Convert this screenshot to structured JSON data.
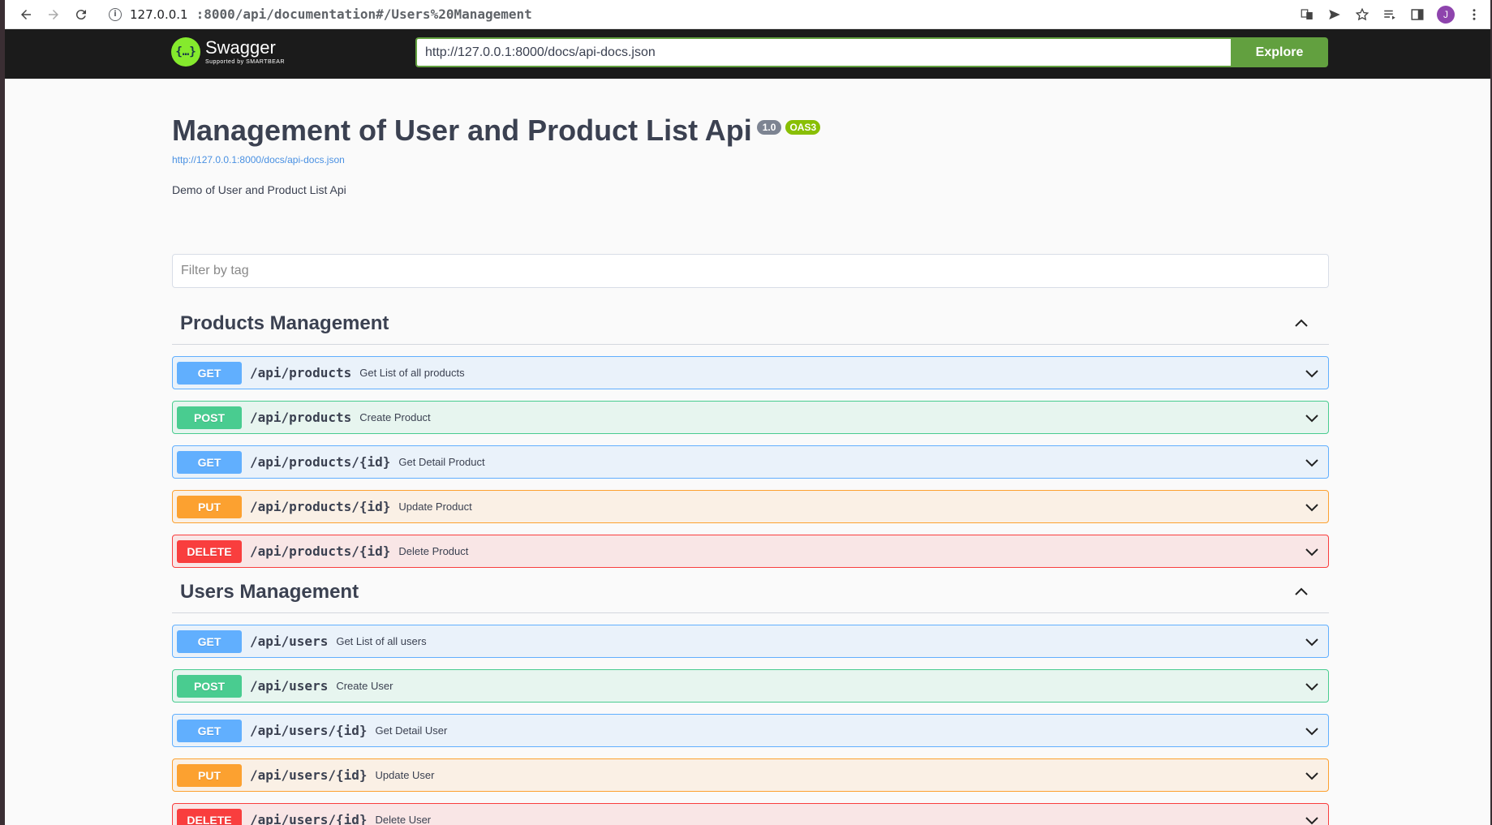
{
  "browser": {
    "url_host": "127.0.0.1",
    "url_path": ":8000/api/documentation#/Users%20Management",
    "avatar_letter": "J"
  },
  "topbar": {
    "logo_name": "Swagger",
    "logo_tagline": "Supported by SMARTBEAR",
    "spec_url": "http://127.0.0.1:8000/docs/api-docs.json",
    "explore_label": "Explore"
  },
  "info": {
    "title": "Management of User and Product List Api",
    "version": "1.0",
    "oas": "OAS3",
    "spec_link": "http://127.0.0.1:8000/docs/api-docs.json",
    "description": "Demo of User and Product List Api"
  },
  "filter": {
    "placeholder": "Filter by tag"
  },
  "sections": [
    {
      "title": "Products Management",
      "ops": [
        {
          "method": "GET",
          "path": "/api/products",
          "summary": "Get List of all products"
        },
        {
          "method": "POST",
          "path": "/api/products",
          "summary": "Create Product"
        },
        {
          "method": "GET",
          "path": "/api/products/{id}",
          "summary": "Get Detail Product"
        },
        {
          "method": "PUT",
          "path": "/api/products/{id}",
          "summary": "Update Product"
        },
        {
          "method": "DELETE",
          "path": "/api/products/{id}",
          "summary": "Delete Product"
        }
      ]
    },
    {
      "title": "Users Management",
      "ops": [
        {
          "method": "GET",
          "path": "/api/users",
          "summary": "Get List of all users"
        },
        {
          "method": "POST",
          "path": "/api/users",
          "summary": "Create User"
        },
        {
          "method": "GET",
          "path": "/api/users/{id}",
          "summary": "Get Detail User"
        },
        {
          "method": "PUT",
          "path": "/api/users/{id}",
          "summary": "Update User"
        },
        {
          "method": "DELETE",
          "path": "/api/users/{id}",
          "summary": "Delete User"
        }
      ]
    }
  ],
  "colors": {
    "get": "#61affe",
    "post": "#49cc90",
    "put": "#fca130",
    "delete": "#f93e3e",
    "explore": "#62a03f"
  }
}
